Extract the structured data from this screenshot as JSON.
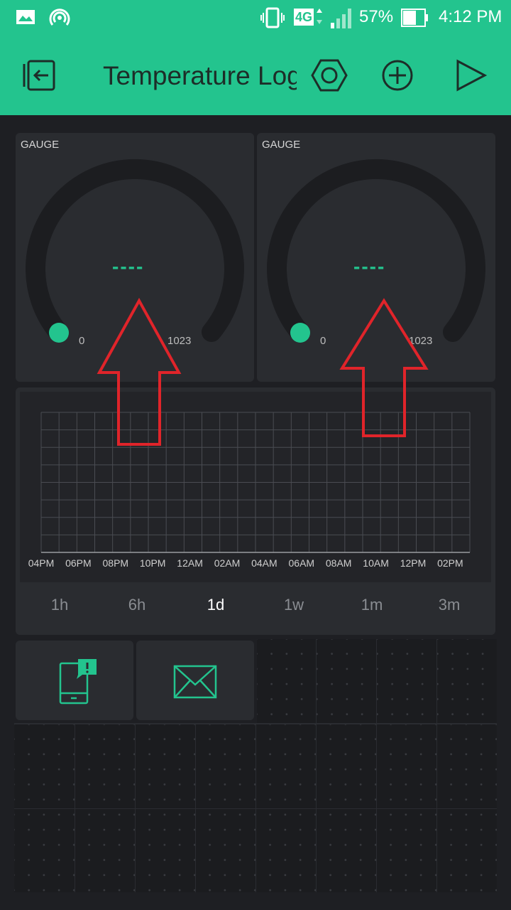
{
  "status_bar": {
    "network": "4G",
    "battery": "57%",
    "time": "4:12 PM",
    "icons": [
      "image-icon",
      "hotspot-icon",
      "vibrate-icon",
      "signal-icon",
      "battery-icon"
    ]
  },
  "toolbar": {
    "title": "Temperature Log",
    "icons": [
      "exit-icon",
      "settings-nut-icon",
      "add-icon",
      "play-icon"
    ]
  },
  "gauges": [
    {
      "label": "GAUGE",
      "value": "----",
      "min": "0",
      "max": "1023"
    },
    {
      "label": "GAUGE",
      "value": "----",
      "min": "0",
      "max": "1023"
    }
  ],
  "chart": {
    "x_ticks": [
      "04PM",
      "06PM",
      "08PM",
      "10PM",
      "12AM",
      "02AM",
      "04AM",
      "06AM",
      "08AM",
      "10AM",
      "12PM",
      "02PM"
    ],
    "ranges": [
      "1h",
      "6h",
      "1d",
      "1w",
      "1m",
      "3m"
    ],
    "selected_range": "1d"
  },
  "widgets": [
    {
      "name": "push-notification-widget",
      "icon": "phone-notification-icon"
    },
    {
      "name": "email-widget",
      "icon": "envelope-icon"
    }
  ],
  "colors": {
    "accent": "#23c48e",
    "background": "#1e1f23",
    "panel": "#2a2c30",
    "annotation_arrow": "#e0242a"
  }
}
